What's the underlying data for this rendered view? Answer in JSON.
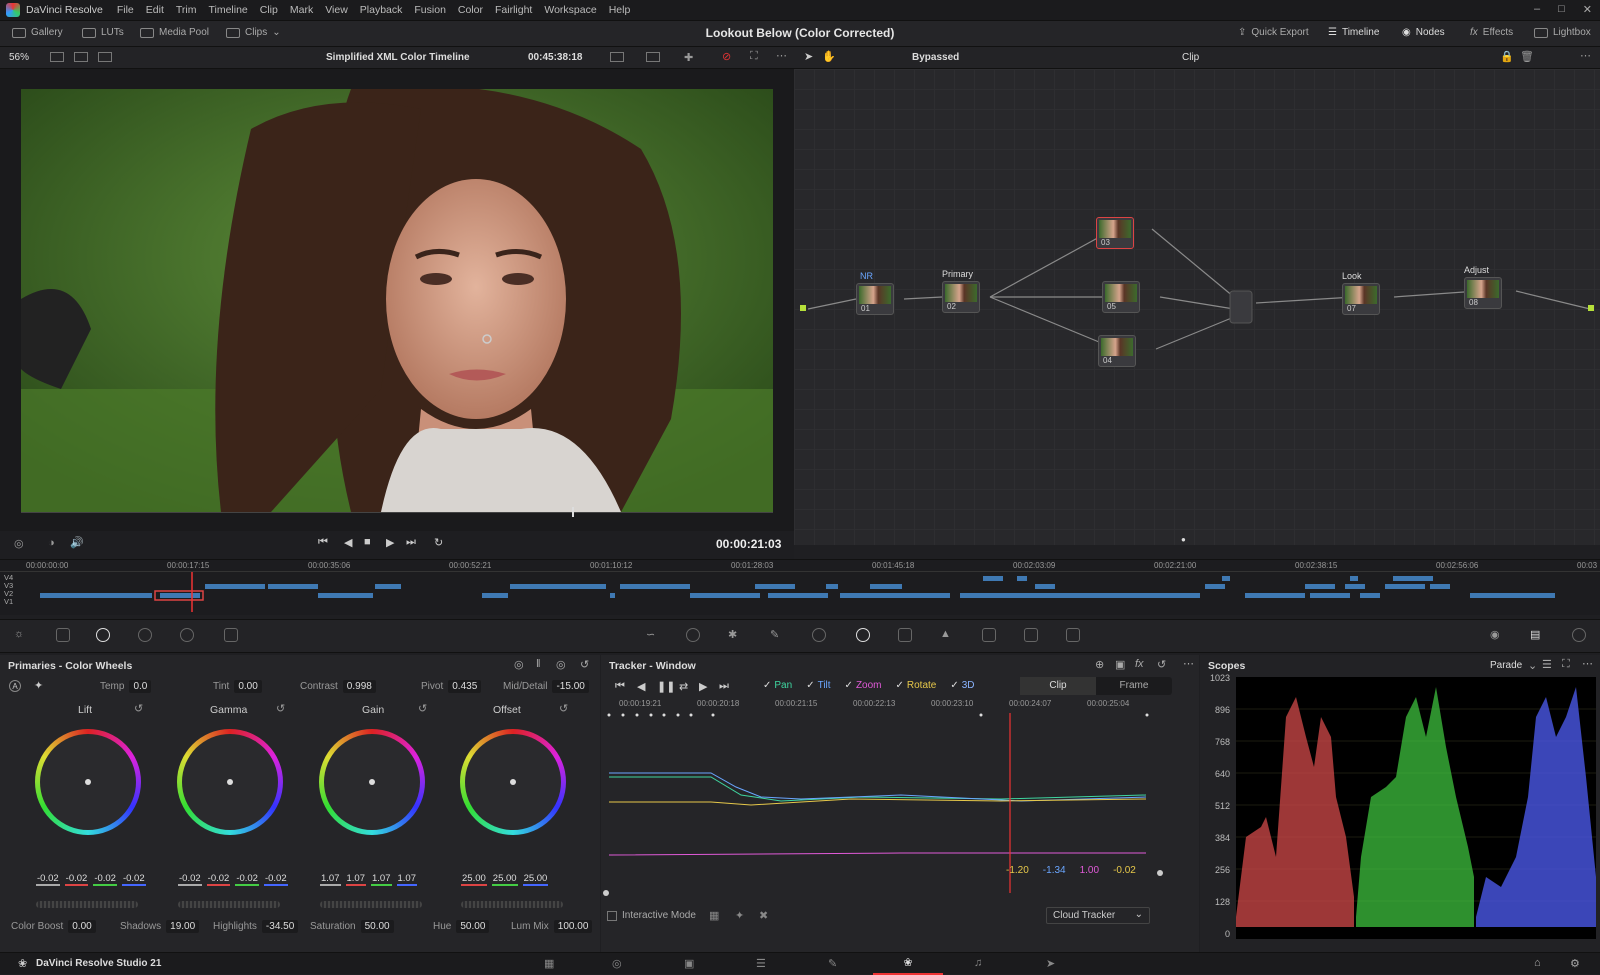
{
  "app": {
    "name": "DaVinci Resolve",
    "menus": [
      "File",
      "Edit",
      "Trim",
      "Timeline",
      "Clip",
      "Mark",
      "View",
      "Playback",
      "Fusion",
      "Color",
      "Fairlight",
      "Workspace",
      "Help"
    ]
  },
  "toolbar": {
    "gallery": "Gallery",
    "luts": "LUTs",
    "media_pool": "Media Pool",
    "clips": "Clips",
    "project_title": "Lookout Below (Color Corrected)",
    "quick_export": "Quick Export",
    "timeline": "Timeline",
    "nodes": "Nodes",
    "effects": "Effects",
    "lightbox": "Lightbox"
  },
  "viewerbar": {
    "zoom": "56%",
    "timeline_name": "Simplified XML Color Timeline",
    "timecode": "00:45:38:18",
    "bypassed": "Bypassed",
    "clip_mode": "Clip"
  },
  "transport": {
    "timecode": "00:00:21:03"
  },
  "timeline": {
    "ruler": [
      "00:00:00:00",
      "00:00:17:15",
      "00:00:35:06",
      "00:00:52:21",
      "00:01:10:12",
      "00:01:28:03",
      "00:01:45:18",
      "00:02:03:09",
      "00:02:21:00",
      "00:02:38:15",
      "00:02:56:06",
      "00:03"
    ],
    "tracks": [
      "V4",
      "V3",
      "V2",
      "V1"
    ]
  },
  "nodes": [
    {
      "label": "NR",
      "num": "01"
    },
    {
      "label": "Primary",
      "num": "02"
    },
    {
      "label": "",
      "num": "03"
    },
    {
      "label": "",
      "num": "05"
    },
    {
      "label": "",
      "num": "04"
    },
    {
      "label": "Look",
      "num": "07"
    },
    {
      "label": "Adjust",
      "num": "08"
    }
  ],
  "primaries": {
    "title": "Primaries - Color Wheels",
    "temp_label": "Temp",
    "temp": "0.0",
    "tint_label": "Tint",
    "tint": "0.00",
    "contrast_label": "Contrast",
    "contrast": "0.998",
    "pivot_label": "Pivot",
    "pivot": "0.435",
    "middetail_label": "Mid/Detail",
    "middetail": "-15.00",
    "wheels": [
      {
        "name": "Lift",
        "values": [
          "-0.02",
          "-0.02",
          "-0.02",
          "-0.02"
        ]
      },
      {
        "name": "Gamma",
        "values": [
          "-0.02",
          "-0.02",
          "-0.02",
          "-0.02"
        ]
      },
      {
        "name": "Gain",
        "values": [
          "1.07",
          "1.07",
          "1.07",
          "1.07"
        ]
      },
      {
        "name": "Offset",
        "values": [
          "25.00",
          "25.00",
          "25.00"
        ]
      }
    ],
    "colorboost_label": "Color Boost",
    "colorboost": "0.00",
    "shadows_label": "Shadows",
    "shadows": "19.00",
    "highlights_label": "Highlights",
    "highlights": "-34.50",
    "saturation_label": "Saturation",
    "saturation": "50.00",
    "hue_label": "Hue",
    "hue": "50.00",
    "lummix_label": "Lum Mix",
    "lummix": "100.00"
  },
  "tracker": {
    "title": "Tracker - Window",
    "checks": [
      "Pan",
      "Tilt",
      "Zoom",
      "Rotate",
      "3D"
    ],
    "check_colors": [
      "#3fd6a0",
      "#6aa6ff",
      "#e05ad8",
      "#e6c84a",
      "#8ab4ff"
    ],
    "mode_clip": "Clip",
    "mode_frame": "Frame",
    "ruler": [
      "00:00:19:21",
      "00:00:20:18",
      "00:00:21:15",
      "00:00:22:13",
      "00:00:23:10",
      "00:00:24:07",
      "00:00:25:04"
    ],
    "values": [
      "-1.20",
      "-1.34",
      "1.00",
      "-0.02"
    ],
    "value_colors": [
      "#e6c84a",
      "#6aa6ff",
      "#e05ad8",
      "#e6c84a"
    ],
    "interactive_mode": "Interactive Mode",
    "tracker_type": "Cloud Tracker"
  },
  "scopes": {
    "title": "Scopes",
    "mode": "Parade",
    "scale": [
      "1023",
      "896",
      "768",
      "640",
      "512",
      "384",
      "256",
      "128",
      "0"
    ]
  },
  "statusbar": {
    "product": "DaVinci Resolve Studio 21"
  }
}
